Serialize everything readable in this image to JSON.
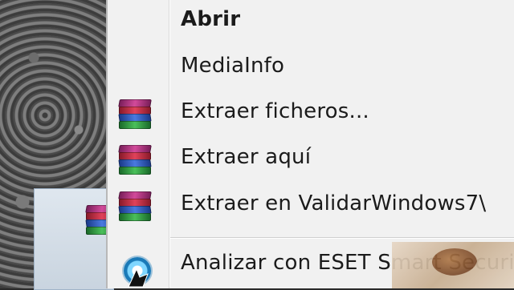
{
  "context_menu": {
    "items": [
      {
        "label": "Abrir",
        "bold": true,
        "icon": ""
      },
      {
        "label": "MediaInfo",
        "bold": false,
        "icon": ""
      },
      {
        "label": "Extraer ficheros...",
        "bold": false,
        "icon": "winrar-icon"
      },
      {
        "label": "Extraer aquí",
        "bold": false,
        "icon": "winrar-icon"
      },
      {
        "label": "Extraer en ValidarWindows7\\",
        "bold": false,
        "icon": "winrar-icon"
      }
    ],
    "eset_item": {
      "label": "Analizar con ESET Smart Securi",
      "icon": "eset-icon"
    }
  },
  "colors": {
    "menu_background": "#f1f1f1",
    "text": "#1b1b1b"
  }
}
